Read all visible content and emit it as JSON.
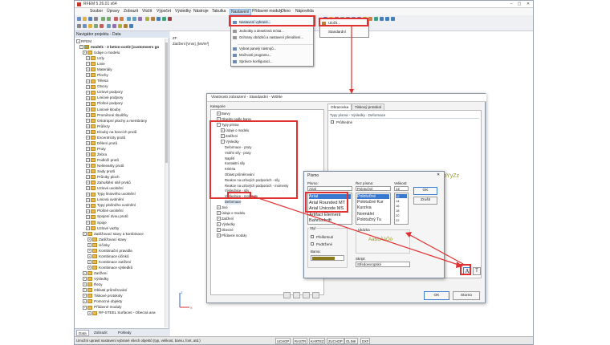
{
  "window": {
    "title": "RFEM 5.26.01 x64",
    "minimize": "–",
    "maximize": "▢",
    "close": "✕"
  },
  "menubar": [
    "Soubor",
    "Úpravy",
    "Zobrazit",
    "Vložit",
    "Výpočet",
    "Výsledky",
    "Nástroje",
    "Tabulka",
    "Nastavení",
    "Přídavné moduly",
    "Okno",
    "Nápověda"
  ],
  "settings_menu": {
    "items": [
      "Nastavení vybrané...",
      "Jednotky a desetinná místa...",
      "Ochrany obrázků a nastavení přenášení...",
      "Vybrat panely nástrojů...",
      "Možnosti programu...",
      "Správce konfigurací..."
    ],
    "submenu": [
      "Uložit...",
      "Standardní"
    ]
  },
  "workarea_text": {
    "line1": "ZF:",
    "line2": "Zatížení [Vnm], [kN/m²]"
  },
  "nav": {
    "header": "Navigátor projektu - Data",
    "root": "RFEM",
    "model": "model1 - 3 beton-ocel2 [customsers go",
    "items": [
      "Údaje o modelu",
      "Uzly",
      "Linie",
      "Materiály",
      "Plochy",
      "Tělesa",
      "Otvory",
      "Uzlové podpory",
      "Liniové podpory",
      "Plošné podpory",
      "Liniové klouby",
      "Proměnné tloušťky",
      "Ortotropní plochy a membrány",
      "Průřezy",
      "Klouby na koncích prutů",
      "Excentricity prutů",
      "Dělení prutů",
      "Pruty",
      "Žebra",
      "Podloží prutů",
      "Nelinearity prutů",
      "Sady prutů",
      "Průniky ploch",
      "Zahuštění sítě prvků",
      "Uzlové uvolnění",
      "Typy liniového uvolnění",
      "Liniová uvolnění",
      "Typy plošného uvolnění",
      "Plošné uvolnění",
      "Spojení dvou prutů",
      "Spoje",
      "Uzlové vazby",
      "Zatěžovací stavy a kombinace",
      "Zatěžovací stavy",
      "Účinky",
      "Kombinační pravidla",
      "Kombinace účinků",
      "Kombinace zatížení",
      "Kombinace výsledků",
      "Zatížení",
      "Výsledky",
      "Řezy",
      "Oblasti průměrování",
      "Tiskové protokoly",
      "Pomocné objekty",
      "Přídavné moduly",
      "RF-STEEL Surfaces - Obecná ana"
    ],
    "tabs": [
      "Data",
      "Zobrazit",
      "Pohledy"
    ]
  },
  "status": {
    "text": "Umožní upravit nastavení vybrané všech objektů (typ, velikost, barvu, font, atd.)",
    "buttons": [
      "UCHOP",
      "RASTR",
      "KARTEZ",
      "ZUCHOP",
      "OLINK",
      "DXF"
    ]
  },
  "dialog": {
    "title": "Vlastnosti zobrazení - Standardní - Wöhle",
    "category_label": "Kategorie",
    "tree": [
      "Barvy",
      "Objekty podle barev",
      "Typy písma",
      "Údaje o modelu",
      "Zatížení",
      "Výsledky",
      "Deformace - pruty",
      "Vnitřní síly - pruty",
      "Napětí",
      "Kontaktní síly",
      "Kritéria",
      "Oblast průměrování",
      "Reakce na uzlových podporách - síly",
      "Reakce na uzlových podporách - momenty",
      "Výslednice - síly",
      "Výslednice - momenty",
      "Deformace",
      "Jiné",
      "Údaje o modelu",
      "Zatížení",
      "Výsledky",
      "Obecné",
      "Přídavné moduly"
    ],
    "tabs": [
      "Obrazovka",
      "Tiskový protokol"
    ],
    "type_header": "Typy písma - Výsledky - Deformace",
    "checkbox": "Průhledné",
    "sample": "AaBbYyZz",
    "ok": "OK",
    "cancel": "Storno"
  },
  "font_dialog": {
    "title": "Písmo",
    "close": "✕",
    "font_label": "Písmo:",
    "font_value": "Arial",
    "fonts": [
      "Arial",
      "Arial Rounded MT",
      "Arial Unicode MS",
      "Artifact Element",
      "Bahnschrift"
    ],
    "style_label": "Řez písma:",
    "style_value": "Polotučné",
    "styles": [
      "Polotučné",
      "Polotučné Kur",
      "Kurzíva",
      "Normální",
      "Polotučný Tu"
    ],
    "size_label": "Velikost:",
    "size_value": "12",
    "sizes": [
      "12",
      "14",
      "16",
      "18",
      "20",
      "22",
      "24"
    ],
    "ok": "OK",
    "cancel": "Zrušit",
    "effects_label": "Styl",
    "strike": "Přeškrtnutí",
    "underline": "Podtržené",
    "color_label": "Barva:",
    "color_value": "#8a7a1a",
    "sample_label": "Ukázka",
    "sample": "AaBbÁáÓó",
    "script_label": "Skript:",
    "script_value": "Středoevropské"
  },
  "colors": {
    "accent_red": "#e03030",
    "selection": "#3a78d0",
    "sample": "#9a9a20"
  }
}
